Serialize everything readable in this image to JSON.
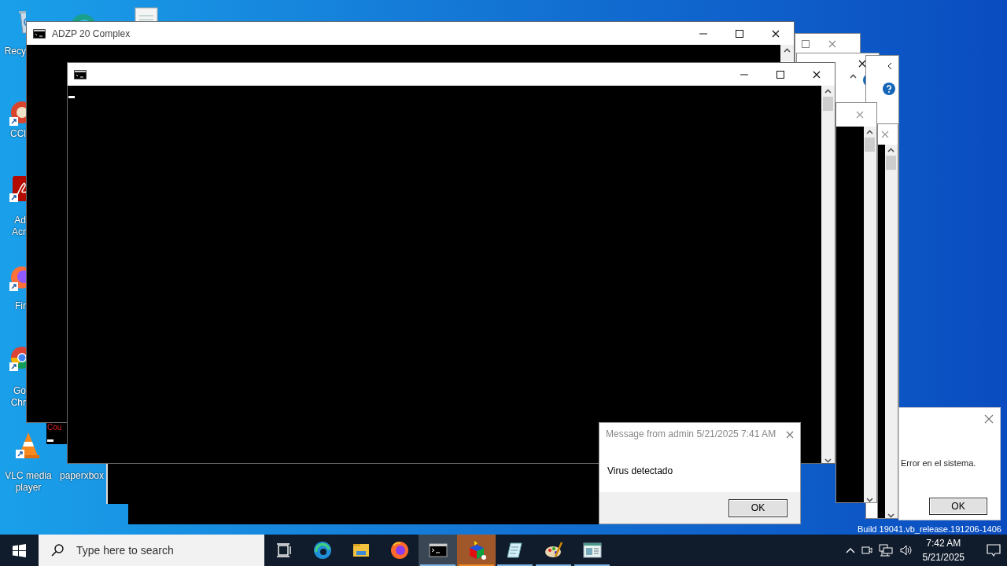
{
  "desktop": {
    "icons": [
      {
        "kind": "recycle",
        "label": "Recy"
      },
      {
        "kind": "edge-top"
      },
      {
        "kind": "document-top"
      },
      {
        "kind": "ccleaner",
        "label": "CCl"
      },
      {
        "kind": "acrobat",
        "label": "Ad\nAcr"
      },
      {
        "kind": "firefox",
        "label": "Fir"
      },
      {
        "kind": "chrome",
        "label": "Go\nChr"
      },
      {
        "kind": "vlc",
        "label": "VLC media\nplayer"
      },
      {
        "label": "paperxbox"
      }
    ],
    "build_text": "Build 19041.vb_release.191206-1406"
  },
  "small_console": {
    "text": "Cou"
  },
  "main_window": {
    "title": "ADZP 20 Complex"
  },
  "front_console": {
    "cursor": true
  },
  "message_box": {
    "title": "Message from admin 5/21/2025 7:41 AM",
    "body": "Virus detectado",
    "button": "OK"
  },
  "error_box": {
    "body": "Error en el sistema.",
    "button": "OK"
  },
  "taskbar": {
    "search_placeholder": "Type here to search",
    "apps": [
      {
        "kind": "taskview",
        "selected": false,
        "running": false,
        "flashing": false
      },
      {
        "kind": "edge",
        "selected": false,
        "running": false,
        "flashing": false
      },
      {
        "kind": "explorer",
        "selected": false,
        "running": false,
        "flashing": false
      },
      {
        "kind": "firefox",
        "selected": false,
        "running": false,
        "flashing": false
      },
      {
        "kind": "cmd",
        "selected": true,
        "running": true,
        "flashing": false
      },
      {
        "kind": "cube",
        "selected": false,
        "running": true,
        "flashing": true
      },
      {
        "kind": "notepad",
        "selected": false,
        "running": true,
        "flashing": false
      },
      {
        "kind": "paint",
        "selected": false,
        "running": true,
        "flashing": false
      },
      {
        "kind": "window",
        "selected": false,
        "running": true,
        "flashing": false
      }
    ],
    "time": "7:42 AM",
    "date": "5/21/2025"
  }
}
